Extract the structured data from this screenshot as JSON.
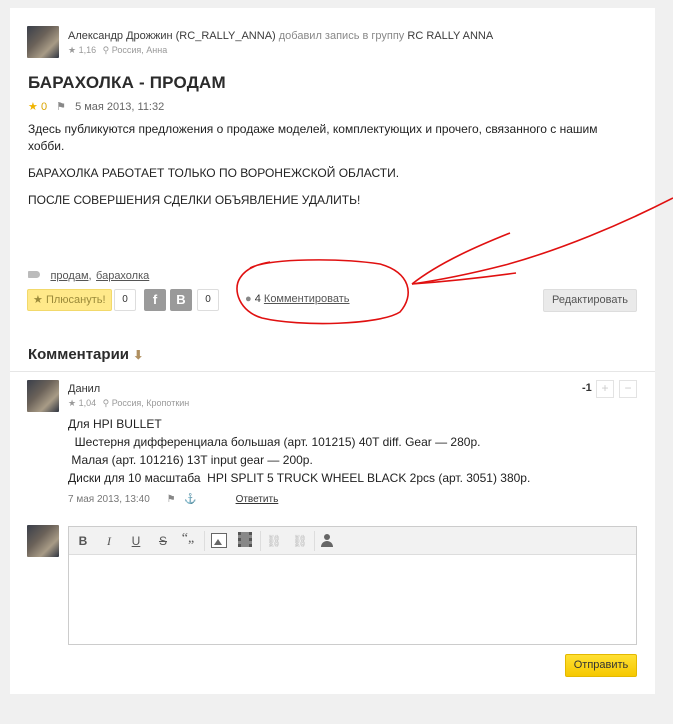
{
  "post": {
    "author_name": "Александр Дрожжин (RC_RALLY_ANNA)",
    "author_action": "добавил запись в группу",
    "group_name": "RC RALLY ANNA",
    "author_rating": "1,16",
    "author_location": "Россия, Анна",
    "title": "БАРАХОЛКА - ПРОДАМ",
    "rating": "0",
    "date": "5 мая 2013, 11:32",
    "paragraphs": [
      "Здесь публикуются предложения о продаже моделей, комплектующих и прочего, связанного с нашим хобби.",
      "БАРАХОЛКА РАБОТАЕТ ТОЛЬКО ПО ВОРОНЕЖСКОЙ ОБЛАСТИ.",
      "ПОСЛЕ СОВЕРШЕНИЯ СДЕЛКИ ОБЪЯВЛЕНИЕ УДАЛИТЬ!"
    ],
    "tags": [
      "продам",
      "барахолка"
    ],
    "tag_separator": ",",
    "plus_label": "Плюсануть!",
    "plus_count": "0",
    "social_fb": "f",
    "social_vk": "B",
    "social_count": "0",
    "comments_count": "4",
    "comment_link": "Комментировать",
    "edit_label": "Редактировать"
  },
  "comments_section": {
    "heading": "Комментарии",
    "sort_arrow": "⬇"
  },
  "comment": {
    "author": "Данил",
    "rating": "1,04",
    "location": "Россия, Кропоткин",
    "score": "-1",
    "plus": "+",
    "minus": "−",
    "lines": [
      "Для HPI BULLET",
      "  Шестерня дифференциала большая (арт. 101215) 40T diff. Gear — 280р.",
      " Малая (арт. 101216) 13T input gear — 200р.",
      "Диски для 10 масштаба  HPI SPLIT 5 TRUCK WHEEL BLACK 2pcs (арт. 3051) 380р."
    ],
    "date": "7 мая 2013, 13:40",
    "reply": "Ответить"
  },
  "editor": {
    "bold": "B",
    "italic": "I",
    "underline": "U",
    "strike": "S",
    "quote": "“„",
    "submit": "Отправить"
  },
  "colors": {
    "annotation_red": "#e01010",
    "accent_yellow": "#f6c800",
    "star": "#f0b400"
  }
}
